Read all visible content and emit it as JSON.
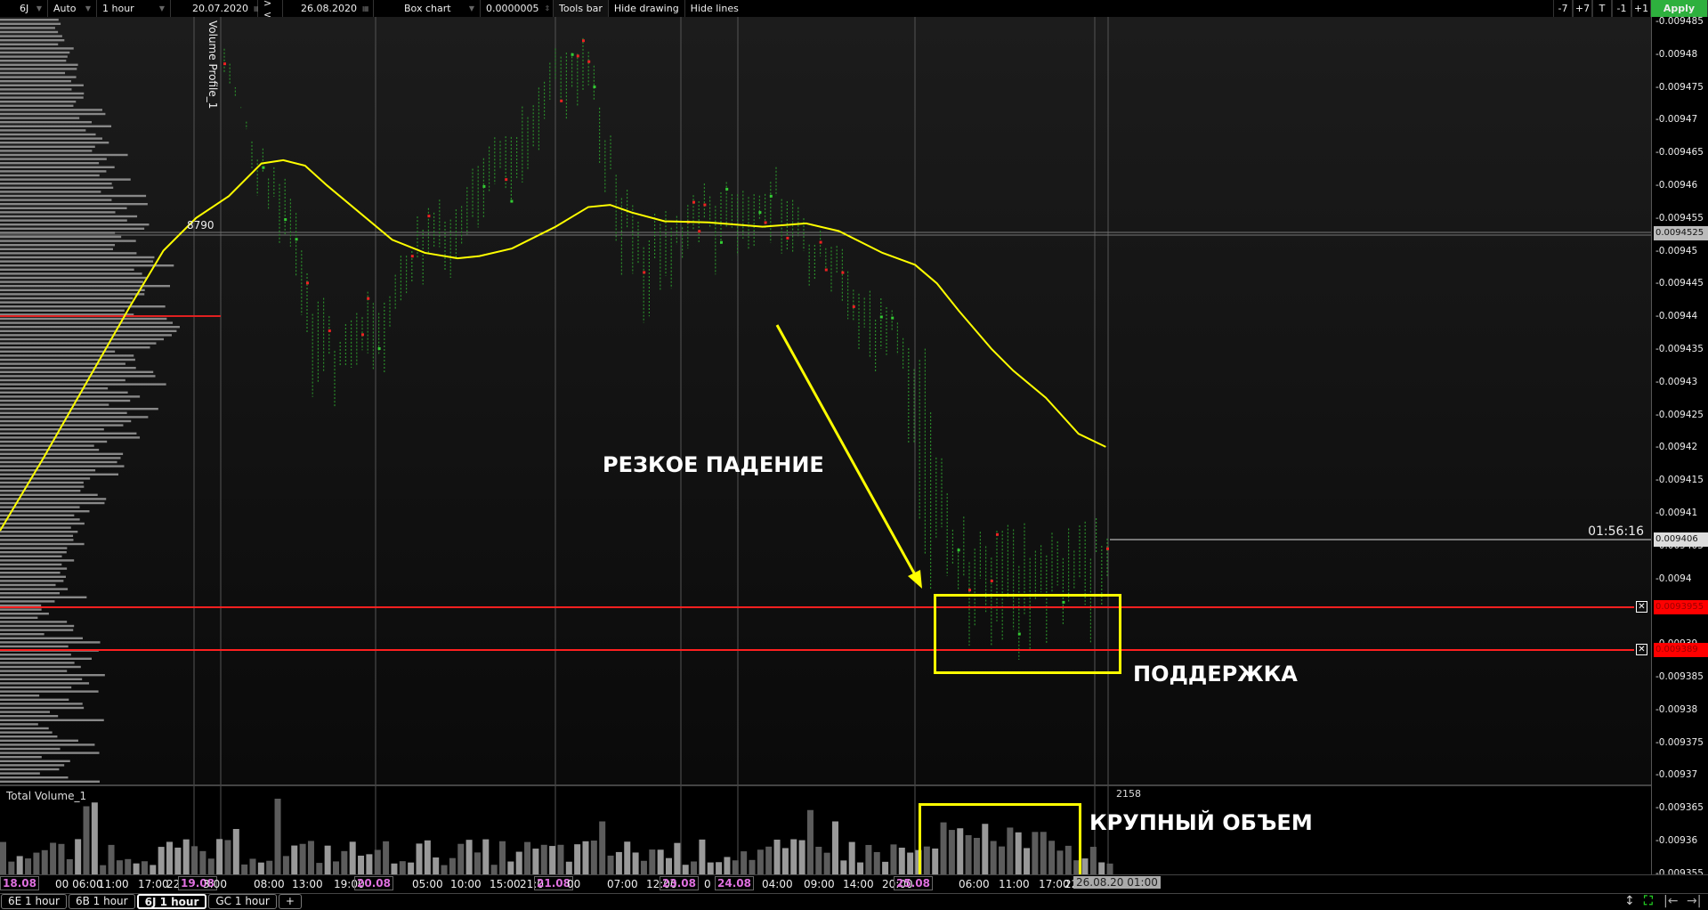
{
  "toolbar": {
    "symbol": "6J",
    "scale": "Auto",
    "timeframe": "1 hour",
    "date_from": "20.07.2020",
    "nav": "> <",
    "date_to": "26.08.2020",
    "chart_type": "Box chart",
    "tick_size": "0.0000005",
    "tools_bar": "Tools bar",
    "hide_drawing": "Hide drawing",
    "hide_lines": "Hide lines",
    "shift_buttons": [
      "-7",
      "+7",
      "T",
      "-1",
      "+1"
    ],
    "apply": "Apply"
  },
  "price_axis": {
    "ticks": [
      "-0.009485",
      "-0.00948",
      "-0.009475",
      "-0.00947",
      "-0.009465",
      "-0.00946",
      "-0.009455",
      "-0.00945",
      "-0.009445",
      "-0.00944",
      "-0.009435",
      "-0.00943",
      "-0.009425",
      "-0.00942",
      "-0.009415",
      "-0.00941",
      "-0.009405",
      "-0.0094",
      "-0.009395",
      "-0.00939",
      "-0.009385",
      "-0.00938",
      "-0.009375",
      "-0.00937",
      "-0.009365",
      "-0.00936",
      "-0.009355"
    ],
    "current_price": "0.009406",
    "poc_price": "0.0094525",
    "support_upper": "0.0093955",
    "support_lower": "0.009389"
  },
  "chart": {
    "indicator_name": "Volume Profile_1",
    "poc_volume": "8790",
    "timer": "01:56:16",
    "volume_indicator": "Total Volume_1",
    "volume_max": "2158",
    "colors": {
      "ma": "#ffff00",
      "support": "#ff2020",
      "annotation": "#ffff00"
    }
  },
  "annotations": {
    "sharp_drop": "РЕЗКОЕ ПАДЕНИЕ",
    "support": "ПОДДЕРЖКА",
    "large_volume": "КРУПНЫЙ ОБЪЕМ"
  },
  "time_axis": [
    {
      "t": "18.08",
      "d": true
    },
    {
      "t": "00 06:00"
    },
    {
      "t": "11:00"
    },
    {
      "t": "17:00"
    },
    {
      "t": "22"
    },
    {
      "t": "19.08",
      "d": true
    },
    {
      "t": "3:00"
    },
    {
      "t": "08:00"
    },
    {
      "t": "13:00"
    },
    {
      "t": "19:00"
    },
    {
      "t": "20.08",
      "d": true
    },
    {
      "t": "05:00"
    },
    {
      "t": "10:00"
    },
    {
      "t": "15:00"
    },
    {
      "t": "21:0"
    },
    {
      "t": "21.08",
      "d": true
    },
    {
      "t": "00"
    },
    {
      "t": "07:00"
    },
    {
      "t": "12:00"
    },
    {
      "t": "23.08",
      "d": true
    },
    {
      "t": "0"
    },
    {
      "t": "24.08",
      "d": true
    },
    {
      "t": "04:00"
    },
    {
      "t": "09:00"
    },
    {
      "t": "14:00"
    },
    {
      "t": "20:00"
    },
    {
      "t": "25.08",
      "d": true
    },
    {
      "t": "06:00"
    },
    {
      "t": "11:00"
    },
    {
      "t": "17:00"
    },
    {
      "t": "22"
    },
    {
      "t": "26.08.20 01:00",
      "c": true
    }
  ],
  "tabs": [
    "6E 1 hour",
    "6B 1 hour",
    "6J 1 hour",
    "GC 1 hour",
    "+"
  ],
  "bottom_icons": [
    "vertical-resize-icon",
    "fit-screen-icon",
    "scroll-start-icon",
    "scroll-end-icon"
  ]
}
